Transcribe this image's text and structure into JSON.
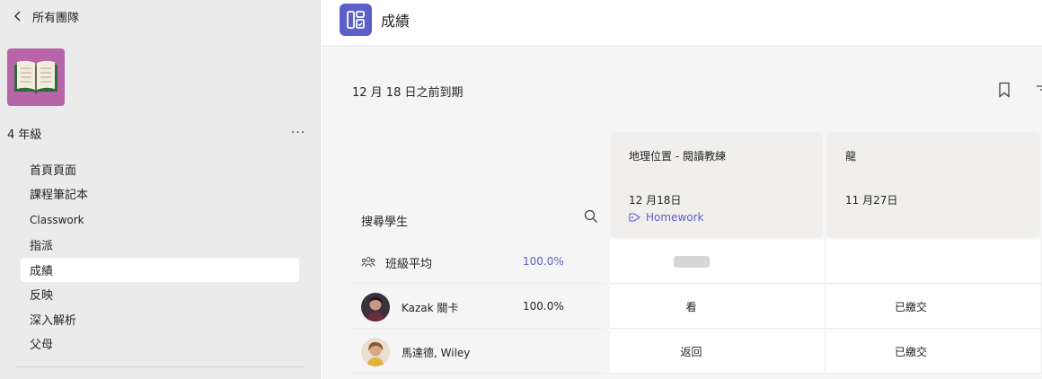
{
  "sidebar": {
    "back_label": "所有團隊",
    "team_name": "4 年級",
    "more_label": "···",
    "nav": [
      {
        "label": "首頁頁面"
      },
      {
        "label": "課程筆記本"
      },
      {
        "label": "指派"
      },
      {
        "label": "成績"
      },
      {
        "label": "反映"
      },
      {
        "label": "深入解析"
      },
      {
        "label": "父母"
      }
    ],
    "section_label": "Classwork"
  },
  "header": {
    "title": "成績",
    "app_icon": "grades-board-icon"
  },
  "main": {
    "due_filter": "12 月 18 日之前到期",
    "search_label": "搜尋學生",
    "assignments": [
      {
        "title": "地理位置 - 閱讀教練",
        "date": "12 月18日",
        "tag": "Homework"
      },
      {
        "title": "龍",
        "date": "11 月27日"
      }
    ],
    "class_average": {
      "label": "班級平均",
      "value": "100.0%"
    },
    "students": [
      {
        "name": "Kazak 關卡",
        "percent": "100.0%",
        "grade_1": "看",
        "grade_2": "已繳交"
      },
      {
        "name": "馬達德, Wiley",
        "percent": "",
        "grade_1": "返回",
        "grade_2": "已繳交"
      }
    ]
  },
  "colors": {
    "accent": "#5b5fc7",
    "team_tile": "#b765a8",
    "sidebar_bg": "#ebebeb"
  }
}
